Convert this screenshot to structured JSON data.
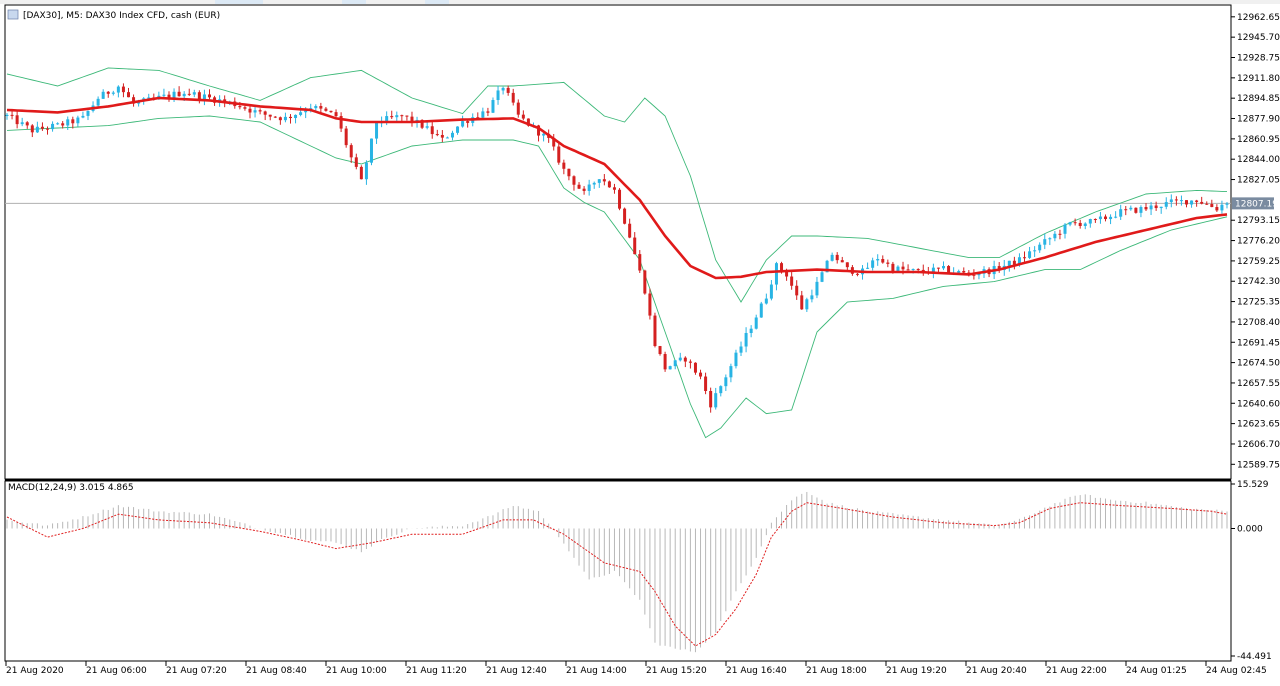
{
  "window": {
    "title": "[DAX30], M5:  DAX30 Index CFD, cash (EUR)",
    "icon": "chart-window-icon"
  },
  "colors": {
    "bull": "#28b4e4",
    "bear": "#d42020",
    "ma": "#e01a1a",
    "bands": "#3cb878",
    "grid_frame": "#000000",
    "bid_line": "#b0b0b0",
    "price_tag_bg": "#7a8ba0",
    "macd_hist": "#b8b8b8",
    "macd_signal": "#e02020"
  },
  "chart_data": [
    {
      "type": "candlestick",
      "title": "[DAX30], M5:  DAX30 Index CFD, cash (EUR)",
      "ylim": [
        12580,
        12970
      ],
      "y_ticks": [
        "12962.65",
        "12945.70",
        "12928.75",
        "12911.80",
        "12894.85",
        "12877.90",
        "12860.95",
        "12844.00",
        "12827.05",
        "12793.15",
        "12776.20",
        "12759.25",
        "12742.30",
        "12725.35",
        "12708.40",
        "12691.45",
        "12674.50",
        "12657.55",
        "12640.60",
        "12623.65",
        "12606.70",
        "12589.75"
      ],
      "current_price_label": "12807.19",
      "current_price": 12807.19,
      "x_tick_labels": [
        "21 Aug 2020",
        "21 Aug 06:00",
        "21 Aug 07:20",
        "21 Aug 08:40",
        "21 Aug 10:00",
        "21 Aug 11:20",
        "21 Aug 12:40",
        "21 Aug 14:00",
        "21 Aug 15:20",
        "21 Aug 16:40",
        "21 Aug 18:00",
        "21 Aug 19:20",
        "21 Aug 20:40",
        "21 Aug 22:00",
        "24 Aug 01:25",
        "24 Aug 02:45"
      ],
      "close_path": [
        [
          0,
          12880
        ],
        [
          5,
          12868
        ],
        [
          10,
          12872
        ],
        [
          15,
          12878
        ],
        [
          18,
          12895
        ],
        [
          22,
          12905
        ],
        [
          25,
          12890
        ],
        [
          30,
          12895
        ],
        [
          35,
          12900
        ],
        [
          40,
          12895
        ],
        [
          45,
          12890
        ],
        [
          50,
          12882
        ],
        [
          55,
          12878
        ],
        [
          60,
          12888
        ],
        [
          65,
          12880
        ],
        [
          68,
          12845
        ],
        [
          70,
          12825
        ],
        [
          73,
          12875
        ],
        [
          78,
          12880
        ],
        [
          82,
          12872
        ],
        [
          86,
          12860
        ],
        [
          90,
          12875
        ],
        [
          95,
          12885
        ],
        [
          98,
          12905
        ],
        [
          101,
          12880
        ],
        [
          104,
          12870
        ],
        [
          107,
          12860
        ],
        [
          110,
          12835
        ],
        [
          114,
          12815
        ],
        [
          117,
          12830
        ],
        [
          120,
          12818
        ],
        [
          123,
          12780
        ],
        [
          126,
          12735
        ],
        [
          128,
          12690
        ],
        [
          130,
          12670
        ],
        [
          134,
          12678
        ],
        [
          137,
          12662
        ],
        [
          139,
          12640
        ],
        [
          141,
          12655
        ],
        [
          144,
          12680
        ],
        [
          147,
          12705
        ],
        [
          150,
          12730
        ],
        [
          152,
          12755
        ],
        [
          154,
          12748
        ],
        [
          157,
          12720
        ],
        [
          160,
          12740
        ],
        [
          163,
          12765
        ],
        [
          166,
          12752
        ],
        [
          169,
          12750
        ],
        [
          172,
          12762
        ],
        [
          175,
          12753
        ],
        [
          180,
          12750
        ],
        [
          185,
          12752
        ],
        [
          190,
          12748
        ],
        [
          195,
          12752
        ],
        [
          200,
          12760
        ],
        [
          205,
          12775
        ],
        [
          210,
          12790
        ],
        [
          215,
          12792
        ],
        [
          220,
          12800
        ],
        [
          225,
          12803
        ],
        [
          230,
          12808
        ],
        [
          235,
          12810
        ],
        [
          239,
          12803
        ],
        [
          241,
          12809
        ]
      ],
      "ma_path": [
        [
          0,
          12885
        ],
        [
          10,
          12883
        ],
        [
          20,
          12888
        ],
        [
          30,
          12895
        ],
        [
          40,
          12893
        ],
        [
          50,
          12888
        ],
        [
          60,
          12885
        ],
        [
          65,
          12878
        ],
        [
          70,
          12875
        ],
        [
          80,
          12875
        ],
        [
          90,
          12877
        ],
        [
          100,
          12878
        ],
        [
          105,
          12870
        ],
        [
          110,
          12855
        ],
        [
          118,
          12840
        ],
        [
          125,
          12810
        ],
        [
          130,
          12780
        ],
        [
          135,
          12755
        ],
        [
          140,
          12745
        ],
        [
          145,
          12746
        ],
        [
          150,
          12750
        ],
        [
          160,
          12752
        ],
        [
          170,
          12750
        ],
        [
          180,
          12750
        ],
        [
          190,
          12748
        ],
        [
          196,
          12752
        ],
        [
          205,
          12762
        ],
        [
          215,
          12775
        ],
        [
          225,
          12785
        ],
        [
          235,
          12795
        ],
        [
          241,
          12798
        ]
      ],
      "upper_band_path": [
        [
          0,
          12915
        ],
        [
          10,
          12905
        ],
        [
          20,
          12920
        ],
        [
          30,
          12918
        ],
        [
          40,
          12905
        ],
        [
          50,
          12893
        ],
        [
          60,
          12912
        ],
        [
          65,
          12915
        ],
        [
          70,
          12918
        ],
        [
          80,
          12895
        ],
        [
          90,
          12882
        ],
        [
          95,
          12905
        ],
        [
          100,
          12905
        ],
        [
          110,
          12908
        ],
        [
          118,
          12880
        ],
        [
          122,
          12875
        ],
        [
          126,
          12895
        ],
        [
          130,
          12880
        ],
        [
          135,
          12830
        ],
        [
          140,
          12760
        ],
        [
          145,
          12725
        ],
        [
          150,
          12760
        ],
        [
          155,
          12780
        ],
        [
          160,
          12780
        ],
        [
          170,
          12778
        ],
        [
          180,
          12770
        ],
        [
          190,
          12762
        ],
        [
          196,
          12762
        ],
        [
          205,
          12782
        ],
        [
          215,
          12800
        ],
        [
          225,
          12815
        ],
        [
          235,
          12818
        ],
        [
          241,
          12817
        ]
      ],
      "lower_band_path": [
        [
          0,
          12868
        ],
        [
          10,
          12870
        ],
        [
          20,
          12872
        ],
        [
          30,
          12878
        ],
        [
          40,
          12880
        ],
        [
          50,
          12875
        ],
        [
          55,
          12865
        ],
        [
          60,
          12855
        ],
        [
          65,
          12845
        ],
        [
          70,
          12840
        ],
        [
          80,
          12855
        ],
        [
          90,
          12860
        ],
        [
          100,
          12860
        ],
        [
          105,
          12855
        ],
        [
          110,
          12820
        ],
        [
          114,
          12808
        ],
        [
          118,
          12800
        ],
        [
          125,
          12760
        ],
        [
          130,
          12700
        ],
        [
          135,
          12640
        ],
        [
          138,
          12612
        ],
        [
          141,
          12620
        ],
        [
          146,
          12645
        ],
        [
          150,
          12632
        ],
        [
          155,
          12635
        ],
        [
          160,
          12700
        ],
        [
          166,
          12725
        ],
        [
          175,
          12728
        ],
        [
          185,
          12738
        ],
        [
          195,
          12742
        ],
        [
          205,
          12752
        ],
        [
          212,
          12752
        ],
        [
          220,
          12768
        ],
        [
          230,
          12785
        ],
        [
          241,
          12796
        ]
      ]
    },
    {
      "type": "bar",
      "title": "MACD(12,24,9) 3.015 4.865",
      "ylim": [
        -44.491,
        15.529
      ],
      "y_ticks": [
        "15.529",
        "0.000",
        "-44.491"
      ],
      "hist_path": [
        [
          0,
          3
        ],
        [
          8,
          1
        ],
        [
          15,
          4
        ],
        [
          22,
          8
        ],
        [
          30,
          6
        ],
        [
          40,
          5
        ],
        [
          50,
          0
        ],
        [
          55,
          -2
        ],
        [
          60,
          -4
        ],
        [
          65,
          -5
        ],
        [
          70,
          -8
        ],
        [
          75,
          -3
        ],
        [
          80,
          0
        ],
        [
          90,
          1
        ],
        [
          95,
          4
        ],
        [
          100,
          8
        ],
        [
          105,
          6
        ],
        [
          110,
          -5
        ],
        [
          115,
          -18
        ],
        [
          120,
          -15
        ],
        [
          125,
          -25
        ],
        [
          128,
          -40
        ],
        [
          132,
          -42
        ],
        [
          136,
          -43
        ],
        [
          140,
          -36
        ],
        [
          144,
          -22
        ],
        [
          148,
          -10
        ],
        [
          151,
          2
        ],
        [
          155,
          10
        ],
        [
          158,
          13
        ],
        [
          162,
          9
        ],
        [
          170,
          6
        ],
        [
          180,
          4
        ],
        [
          190,
          2
        ],
        [
          195,
          1
        ],
        [
          200,
          3
        ],
        [
          206,
          8
        ],
        [
          212,
          12
        ],
        [
          218,
          10
        ],
        [
          225,
          9
        ],
        [
          233,
          7
        ],
        [
          241,
          6
        ]
      ],
      "signal_path": [
        [
          0,
          4
        ],
        [
          8,
          -3
        ],
        [
          15,
          0
        ],
        [
          22,
          5
        ],
        [
          30,
          3
        ],
        [
          40,
          2
        ],
        [
          50,
          -1
        ],
        [
          58,
          -4
        ],
        [
          65,
          -7
        ],
        [
          72,
          -5
        ],
        [
          80,
          -2
        ],
        [
          90,
          -2
        ],
        [
          98,
          3
        ],
        [
          104,
          3
        ],
        [
          110,
          -2
        ],
        [
          118,
          -12
        ],
        [
          125,
          -15
        ],
        [
          128,
          -22
        ],
        [
          132,
          -34
        ],
        [
          136,
          -41
        ],
        [
          140,
          -37
        ],
        [
          144,
          -28
        ],
        [
          148,
          -16
        ],
        [
          151,
          -3
        ],
        [
          155,
          6
        ],
        [
          158,
          9
        ],
        [
          165,
          7
        ],
        [
          175,
          4
        ],
        [
          185,
          2
        ],
        [
          195,
          1
        ],
        [
          200,
          2
        ],
        [
          206,
          7
        ],
        [
          212,
          9
        ],
        [
          220,
          8
        ],
        [
          230,
          7
        ],
        [
          238,
          6
        ],
        [
          241,
          5
        ]
      ]
    }
  ]
}
